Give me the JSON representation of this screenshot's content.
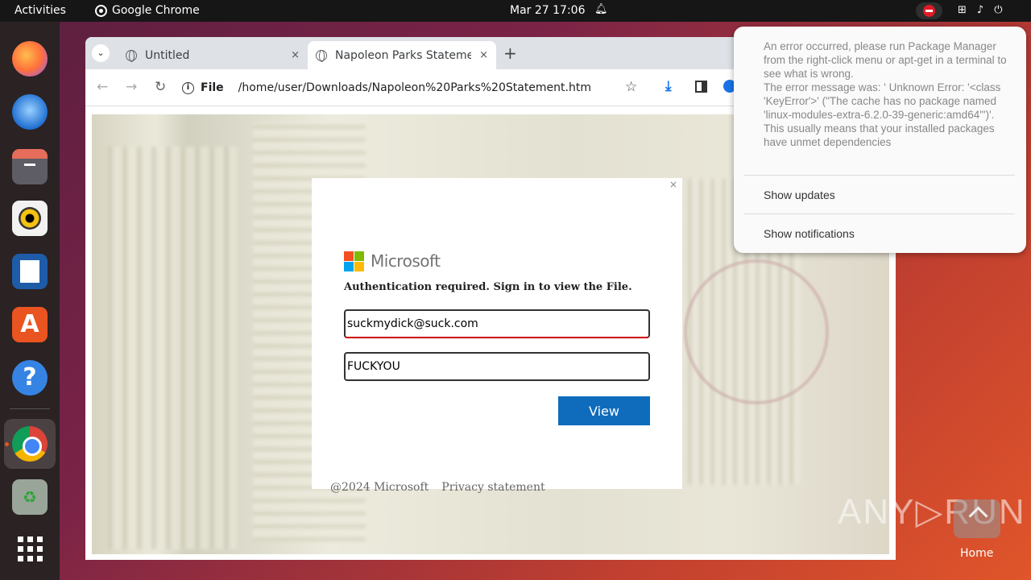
{
  "topbar": {
    "activities": "Activities",
    "app_name": "Google Chrome",
    "clock": "Mar 27  17:06"
  },
  "chrome": {
    "tabs": [
      {
        "title": "Untitled",
        "close": "×"
      },
      {
        "title": "Napoleon Parks Stateme",
        "close": "×"
      }
    ],
    "new_tab": "+",
    "address_scheme": "File",
    "address_path": "/home/user/Downloads/Napoleon%20Parks%20Statement.htm"
  },
  "modal": {
    "close": "×",
    "brand": "Microsoft",
    "auth_text": "Authentication required. Sign in to view the File.",
    "email_value": "suckmydick@suck.com",
    "password_value": "FUCKYOU",
    "view_button": "View",
    "footer_copyright": "@2024 Microsoft",
    "footer_privacy": "Privacy statement"
  },
  "notification": {
    "message": "An error occurred, please run Package Manager from the right-click menu or apt-get in a terminal to see what is wrong.\nThe error message was: ' Unknown Error: '<class 'KeyError'>' (\"The cache has no package named 'linux-modules-extra-6.2.0-39-generic:amd64'\")'. This usually means that your installed packages have unmet dependencies",
    "show_updates": "Show updates",
    "show_notifications": "Show notifications"
  },
  "watermark": "ANY▷RUN",
  "home_label": "Home",
  "colors": {
    "ms_red": "#f25022",
    "ms_green": "#7fba00",
    "ms_blue": "#00a4ef",
    "ms_yellow": "#ffb900",
    "view_button": "#0f6cbd",
    "ubuntu_orange": "#e95420"
  },
  "icons": [
    "firefox-icon",
    "thunderbird-icon",
    "files-icon",
    "rhythmbox-icon",
    "writer-icon",
    "app-center-icon",
    "help-icon",
    "chrome-icon",
    "trash-icon",
    "app-grid-icon"
  ]
}
